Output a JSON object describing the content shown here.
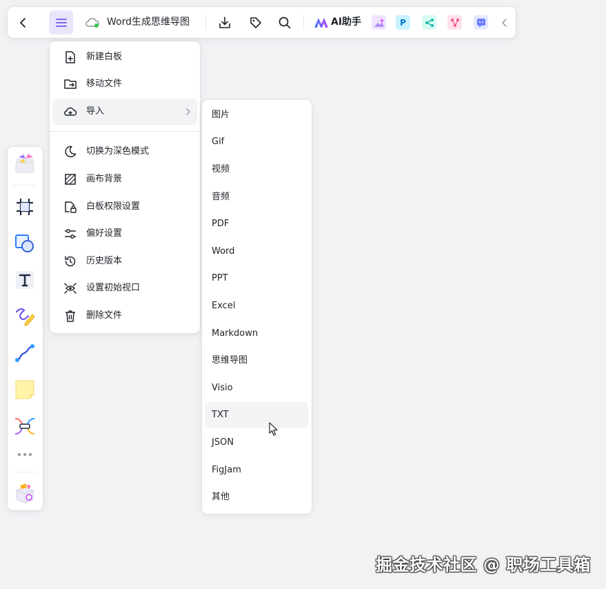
{
  "toolbar": {
    "doc_title": "Word生成思维导图",
    "ai_label": "AI助手",
    "app_p_label": "P"
  },
  "main_menu": {
    "items": [
      {
        "label": "新建白板",
        "icon": "new-board-icon"
      },
      {
        "label": "移动文件",
        "icon": "move-folder-icon"
      },
      {
        "label": "导入",
        "icon": "cloud-upload-icon",
        "has_submenu": true
      },
      {
        "label": "切换为深色模式",
        "icon": "moon-icon"
      },
      {
        "label": "画布背景",
        "icon": "canvas-background-icon"
      },
      {
        "label": "白板权限设置",
        "icon": "lock-file-icon"
      },
      {
        "label": "偏好设置",
        "icon": "sliders-icon"
      },
      {
        "label": "历史版本",
        "icon": "history-icon"
      },
      {
        "label": "设置初始视口",
        "icon": "eye-viewport-icon"
      },
      {
        "label": "删除文件",
        "icon": "trash-icon"
      }
    ]
  },
  "import_submenu": {
    "items": [
      "图片",
      "Gif",
      "视频",
      "音频",
      "PDF",
      "Word",
      "PPT",
      "Excel",
      "Markdown",
      "思维导图",
      "Visio",
      "TXT",
      "JSON",
      "FigJam",
      "其他"
    ],
    "hovered": "TXT"
  },
  "sidebar": {
    "tools": [
      "templates-icon",
      "frame-icon",
      "shape-icon",
      "text-icon",
      "pen-icon",
      "connector-icon",
      "sticky-note-icon",
      "mindmap-icon",
      "more-icon",
      "plugin-box-icon"
    ]
  },
  "watermark": "掘金技术社区 @ 职场工具箱",
  "colors": {
    "accent": "#6b57e8",
    "hover_bg": "#f2f3f5",
    "background": "#f2f2f5"
  }
}
